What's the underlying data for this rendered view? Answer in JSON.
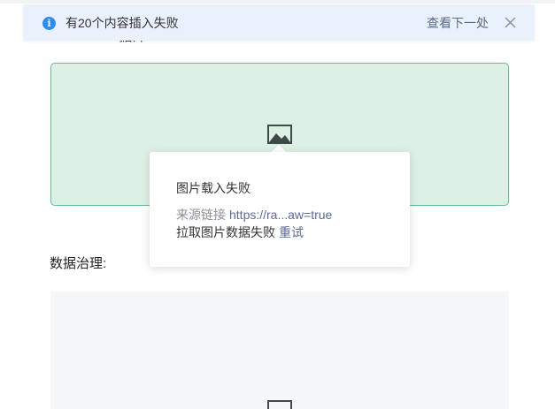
{
  "notice": {
    "icon": "info-icon",
    "message": "有20个内容插入失败",
    "next_label": "查看下一处",
    "close_icon": "close-icon",
    "background": "#e8f1fc",
    "accent": "#2d8cf0"
  },
  "content": {
    "hidden_text": "…… …… 据库"
  },
  "image_error": {
    "icon": "image-icon",
    "box_background": "#dcf0e6",
    "box_border": "#5fc08e",
    "popover": {
      "title": "图片载入失败",
      "source_label": "来源链接",
      "source_link": "https://ra...aw=true",
      "fetch_label": "拉取图片数据失败",
      "retry_label": "重试"
    }
  },
  "section": {
    "heading": "数据治理:",
    "image_icon": "image-icon"
  }
}
